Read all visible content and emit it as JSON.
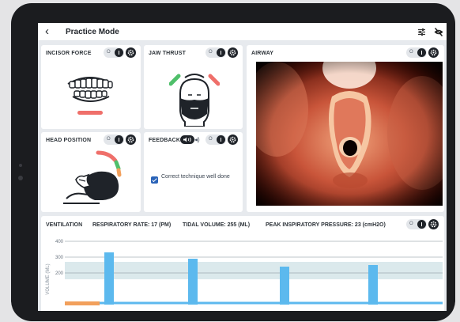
{
  "header": {
    "back_icon": "chevron-left",
    "title": "Practice Mode",
    "icons": [
      "sliders-icon",
      "eye-off-icon"
    ]
  },
  "controls": {
    "off_label": "O",
    "info_icon": "info-icon",
    "settings_icon": "gear-icon"
  },
  "panels": {
    "incisor_force": {
      "title": "INCISOR FORCE"
    },
    "jaw_thrust": {
      "title": "JAW THRUST"
    },
    "airway": {
      "title": "AIRWAY"
    },
    "head_position": {
      "title": "HEAD POSITION"
    },
    "feedback": {
      "title": "FEEDBACK",
      "message": "Correct technique well done",
      "checked": true
    }
  },
  "ventilation": {
    "title": "VENTILATION",
    "respiratory_rate": "RESPIRATORY RATE: 17 (PM)",
    "tidal_volume": "TIDAL VOLUME: 255 (ML)",
    "peak_pressure": "PEAK INSPIRATORY PRESSURE: 23 (cmH2O)"
  },
  "colors": {
    "accent_red": "#ef6f6a",
    "accent_green": "#4fbf6a",
    "accent_orange": "#f2a05c",
    "bar_blue": "#5cb9ee",
    "band_teal": "#dbe9ec"
  },
  "chart_data": {
    "type": "bar",
    "ylabel": "VOLUME (ML)",
    "y_ticks": [
      200,
      300,
      400
    ],
    "ylim": [
      0,
      460
    ],
    "bars": [
      330,
      290,
      240,
      250
    ]
  }
}
